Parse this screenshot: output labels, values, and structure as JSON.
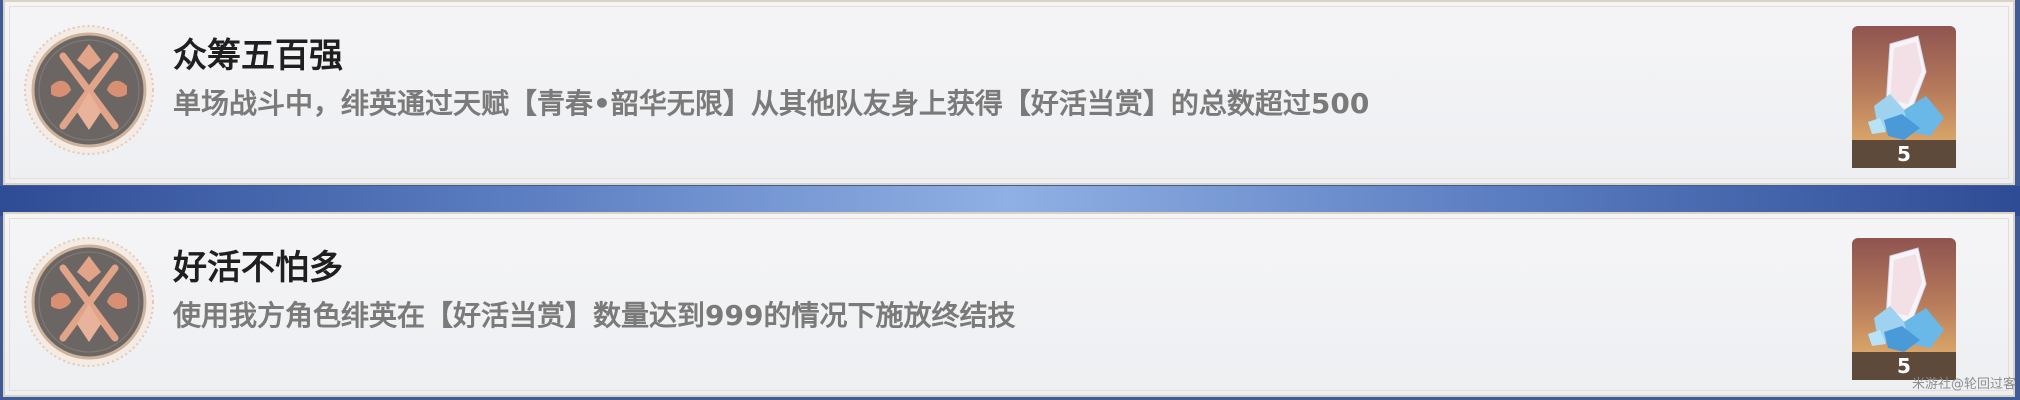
{
  "achievements": [
    {
      "title": "众筹五百强",
      "description": "单场战斗中，绯英通过天赋【青春•韶华无限】从其他队友身上获得【好活当赏】的总数超过500",
      "badge_icon": "crossed-oars-badge-icon",
      "reward": {
        "icon": "stellar-jade-icon",
        "count": "5"
      }
    },
    {
      "title": "好活不怕多",
      "description": "使用我方角色绯英在【好活当赏】数量达到999的情况下施放终结技",
      "badge_icon": "crossed-oars-badge-icon",
      "reward": {
        "icon": "stellar-jade-icon",
        "count": "5"
      }
    }
  ],
  "watermark": "米游社@轮回过客",
  "colors": {
    "card_background": "#f2f2f4",
    "card_border": "#dcd2c4",
    "divider_blue": "#5a7cc0",
    "title_text": "#1f1f1f",
    "description_text": "#7a7a7a",
    "reward_footer": "#5d4a3b"
  }
}
